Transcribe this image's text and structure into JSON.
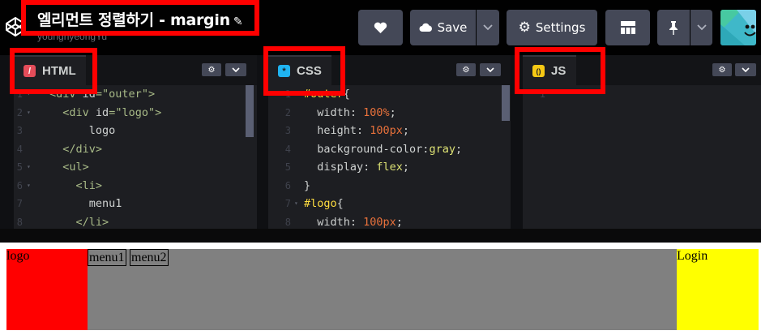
{
  "header": {
    "title": "엘리먼트 정렬하기 - margin",
    "edit_icon": "pencil-icon",
    "username": "younghyeongYu",
    "logo_icon": "codepen-cube-icon",
    "buttons": {
      "heart_icon": "heart-icon",
      "save_label": "Save",
      "save_icon": "cloud-icon",
      "settings_label": "Settings",
      "settings_icon": "gear-icon",
      "layout_icon": "layout-icon",
      "pin_icon": "pin-icon",
      "dropdown_icon": "chevron-down-icon"
    }
  },
  "editors": {
    "html": {
      "tab_label": "HTML",
      "tab_icon_glyph": "/",
      "lines": [
        {
          "n": "1",
          "fold": "▾",
          "parts": [
            [
              "c-tag",
              "<div "
            ],
            [
              "c-attr",
              "id"
            ],
            [
              "c-tag",
              "="
            ],
            [
              "c-val",
              "\"outer\""
            ],
            [
              "c-tag",
              ">"
            ]
          ]
        },
        {
          "n": "2",
          "fold": "▾",
          "parts": [
            [
              "c-tag",
              "  <div "
            ],
            [
              "c-attr",
              "id"
            ],
            [
              "c-tag",
              "="
            ],
            [
              "c-val",
              "\"logo\""
            ],
            [
              "c-tag",
              ">"
            ]
          ]
        },
        {
          "n": "3",
          "fold": "",
          "parts": [
            [
              "c-attr",
              "      logo"
            ]
          ]
        },
        {
          "n": "4",
          "fold": "",
          "parts": [
            [
              "c-tag",
              "  </div>"
            ]
          ]
        },
        {
          "n": "5",
          "fold": "▾",
          "parts": [
            [
              "c-tag",
              "  <ul>"
            ]
          ]
        },
        {
          "n": "6",
          "fold": "▾",
          "parts": [
            [
              "c-tag",
              "    <li>"
            ]
          ]
        },
        {
          "n": "7",
          "fold": "",
          "parts": [
            [
              "c-attr",
              "      menu1"
            ]
          ]
        },
        {
          "n": "8",
          "fold": "",
          "parts": [
            [
              "c-tag",
              "    </li>"
            ]
          ]
        }
      ]
    },
    "css": {
      "tab_label": "CSS",
      "tab_icon_glyph": "*",
      "lines": [
        {
          "n": "1",
          "fold": "▾",
          "parts": [
            [
              "c-sel",
              "#outer"
            ],
            [
              "c-prop",
              "{"
            ]
          ]
        },
        {
          "n": "2",
          "fold": "",
          "parts": [
            [
              "c-prop",
              "  width: "
            ],
            [
              "c-num",
              "100%"
            ],
            [
              "c-prop",
              ";"
            ]
          ]
        },
        {
          "n": "3",
          "fold": "",
          "parts": [
            [
              "c-prop",
              "  height: "
            ],
            [
              "c-num",
              "100px"
            ],
            [
              "c-prop",
              ";"
            ]
          ]
        },
        {
          "n": "4",
          "fold": "",
          "parts": [
            [
              "c-prop",
              "  background-color:"
            ],
            [
              "c-kw",
              "gray"
            ],
            [
              "c-prop",
              ";"
            ]
          ]
        },
        {
          "n": "5",
          "fold": "",
          "parts": [
            [
              "c-prop",
              "  display: "
            ],
            [
              "c-kw",
              "flex"
            ],
            [
              "c-prop",
              ";"
            ]
          ]
        },
        {
          "n": "6",
          "fold": "",
          "parts": [
            [
              "c-prop",
              "}"
            ]
          ]
        },
        {
          "n": "7",
          "fold": "▾",
          "parts": [
            [
              "c-sel",
              "#logo"
            ],
            [
              "c-prop",
              "{"
            ]
          ]
        },
        {
          "n": "8",
          "fold": "",
          "parts": [
            [
              "c-prop",
              "  width: "
            ],
            [
              "c-num",
              "100px"
            ],
            [
              "c-prop",
              ";"
            ]
          ]
        }
      ]
    },
    "js": {
      "tab_label": "JS",
      "tab_icon_glyph": "()",
      "lines": [
        {
          "n": "1",
          "fold": "",
          "parts": []
        }
      ]
    },
    "settings_icon": "gear-icon",
    "dropdown_icon": "chevron-down-icon"
  },
  "preview": {
    "logo_text": "logo",
    "menu_items": [
      "menu1",
      "menu2"
    ],
    "login_text": "Login"
  },
  "colors": {
    "header_bg": "#010101",
    "button_bg": "#444857",
    "editor_bg": "#1d1e22",
    "highlight": "#ff0000",
    "preview_outer": "#808080",
    "preview_logo": "#ff0000",
    "preview_login": "#ffff00"
  }
}
